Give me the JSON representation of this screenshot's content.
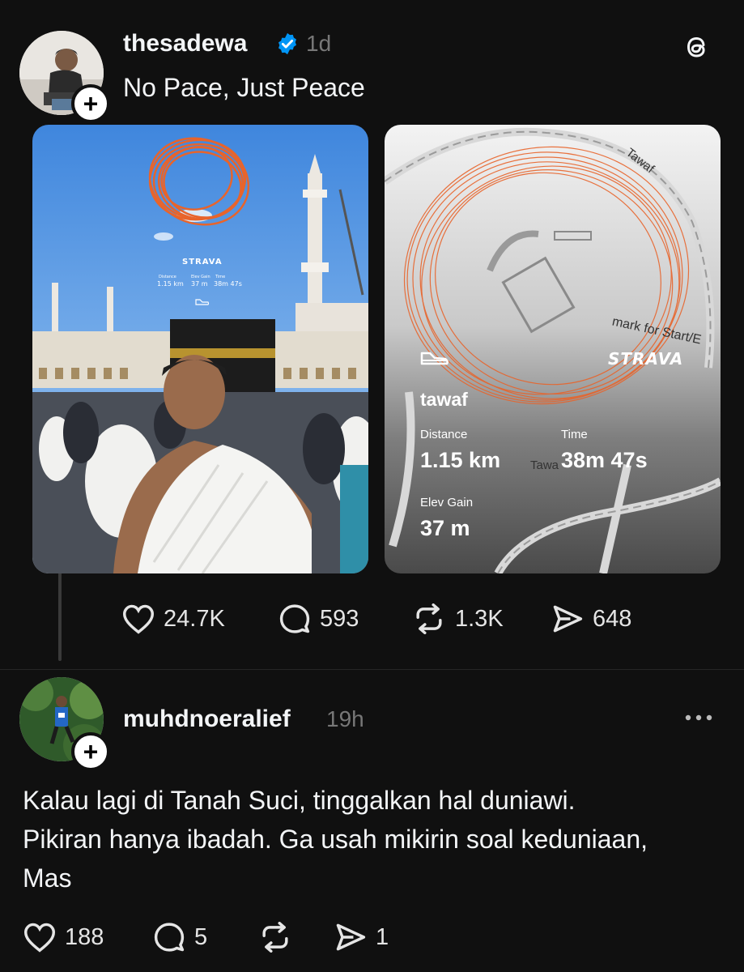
{
  "post": {
    "username": "thesadewa",
    "time": "1d",
    "text": "No Pace, Just Peace",
    "photo_overlay": {
      "brand": "STRAVA",
      "stats": [
        {
          "label": "Distance",
          "value": "1.15 km"
        },
        {
          "label": "Elev Gain",
          "value": "37 m"
        },
        {
          "label": "Time",
          "value": "38m 47s"
        }
      ]
    },
    "activity_card": {
      "brand": "STRAVA",
      "activity_name": "tawaf",
      "distance_label": "Distance",
      "distance_value": "1.15 km",
      "time_label": "Time",
      "time_value": "38m 47s",
      "elev_label": "Elev Gain",
      "elev_value": "37 m",
      "map_label_1": "Tawaf",
      "map_label_2": "mark for Start/E",
      "map_label_3": "Tawa"
    },
    "actions": {
      "likes": "24.7K",
      "replies": "593",
      "reposts": "1.3K",
      "shares": "648"
    }
  },
  "reply": {
    "username": "muhdnoeralief",
    "time": "19h",
    "text_line1": "Kalau lagi di Tanah Suci, tinggalkan hal duniawi.",
    "text_line2": "Pikiran hanya ibadah. Ga usah mikirin soal keduniaan,",
    "text_line3": "Mas",
    "actions": {
      "likes": "188",
      "replies": "5",
      "reposts": "",
      "shares": "1"
    }
  },
  "icons": {
    "threads_logo": "threads-icon",
    "verified": "verified-badge-icon",
    "more": "more-icon"
  },
  "colors": {
    "background": "#101010",
    "verified": "#0095f6",
    "strava_track": "#e8642b"
  }
}
